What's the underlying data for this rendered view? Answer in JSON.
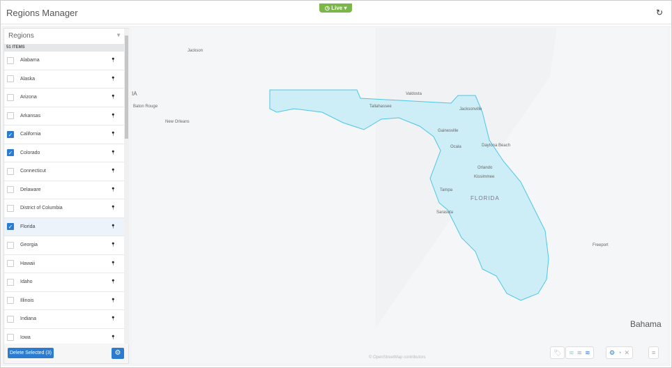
{
  "header": {
    "title": "Regions Manager",
    "live_label": "Live"
  },
  "panel": {
    "title": "Regions",
    "count": "51 ITEMS",
    "delete_label": "Delete Selected (3)",
    "items": [
      {
        "name": "Alabama",
        "checked": false
      },
      {
        "name": "Alaska",
        "checked": false
      },
      {
        "name": "Arizona",
        "checked": false
      },
      {
        "name": "Arkansas",
        "checked": false
      },
      {
        "name": "California",
        "checked": true
      },
      {
        "name": "Colorado",
        "checked": true
      },
      {
        "name": "Connecticut",
        "checked": false
      },
      {
        "name": "Delaware",
        "checked": false
      },
      {
        "name": "District of Columbia",
        "checked": false
      },
      {
        "name": "Florida",
        "checked": true,
        "selected": true
      },
      {
        "name": "Georgia",
        "checked": false
      },
      {
        "name": "Hawaii",
        "checked": false
      },
      {
        "name": "Idaho",
        "checked": false
      },
      {
        "name": "Illinois",
        "checked": false
      },
      {
        "name": "Indiana",
        "checked": false
      },
      {
        "name": "Iowa",
        "checked": false
      }
    ]
  },
  "map": {
    "attribution": "© OpenStreetMap contributors",
    "region_fill": "#cdeef6",
    "region_stroke": "#4cc6e8",
    "labels": [
      {
        "t": "Jackson"
      },
      {
        "t": "IA"
      },
      {
        "t": "Baton Rouge"
      },
      {
        "t": "New Orleans"
      },
      {
        "t": "Valdosta"
      },
      {
        "t": "Tallahassee"
      },
      {
        "t": "Jacksonville"
      },
      {
        "t": "Gainesville"
      },
      {
        "t": "Ocala"
      },
      {
        "t": "Daytona Beach"
      },
      {
        "t": "Orlando"
      },
      {
        "t": "Kissimmee"
      },
      {
        "t": "Tampa"
      },
      {
        "t": "FLORIDA"
      },
      {
        "t": "Sarasota"
      },
      {
        "t": "Freeport"
      },
      {
        "t": "Bahama"
      }
    ]
  }
}
